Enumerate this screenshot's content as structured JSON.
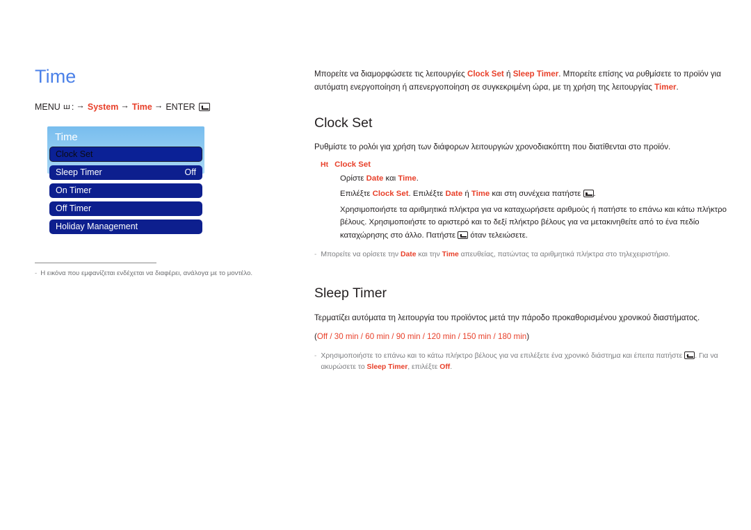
{
  "page": {
    "title": "Time"
  },
  "breadcrumb": {
    "menu_label": "MENU",
    "menu_glyph": "ш",
    "colon": ":",
    "arrow": "→",
    "step1": "System",
    "step2": "Time",
    "enter_label": "ENTER",
    "enter_icon": "enter-key-icon"
  },
  "osd": {
    "title": "Time",
    "items": [
      {
        "label": "Clock Set",
        "value": "",
        "selected": true
      },
      {
        "label": "Sleep Timer",
        "value": "Off",
        "selected": false
      },
      {
        "label": "On Timer",
        "value": "",
        "selected": false
      },
      {
        "label": "Off Timer",
        "value": "",
        "selected": false
      },
      {
        "label": "Holiday Management",
        "value": "",
        "selected": false
      }
    ]
  },
  "osd_footnote": {
    "dash": "-",
    "text": "Η εικόνα που εμφανίζεται ενδέχεται να διαφέρει, ανάλογα με το μοντέλο."
  },
  "intro": {
    "part1": "Μπορείτε να διαμορφώσετε τις λειτουργίες ",
    "term1": "Clock Set",
    "part2": " ή ",
    "term2": "Sleep Timer",
    "part3": ". Μπορείτε επίσης να ρυθμίσετε το προϊόν για αυτόματη ενεργοποίηση ή απενεργοποίηση σε συγκεκριμένη ώρα, με τη χρήση της λειτουργίας ",
    "term3": "Timer",
    "part4": "."
  },
  "clock_set": {
    "heading": "Clock Set",
    "lead": "Ρυθμίστε το ρολόι για χρήση των διάφορων λειτουργιών χρονοδιακόπτη που διατίθενται στο προϊόν.",
    "sub_marker": "Ht",
    "sub_title": "Clock Set",
    "sub_line1_a": "Ορίστε ",
    "sub_line1_b": "Date",
    "sub_line1_c": " και ",
    "sub_line1_d": "Time",
    "sub_line1_e": ".",
    "sub_line2_a": "Επιλέξτε ",
    "sub_line2_b": "Clock Set",
    "sub_line2_c": ". Επιλέξτε ",
    "sub_line2_d": "Date",
    "sub_line2_e": " ή ",
    "sub_line2_f": "Time",
    "sub_line2_g": " και στη συνέχεια πατήστε ",
    "sub_line2_h": ".",
    "sub_line3_a": "Χρησιμοποιήστε τα αριθμητικά πλήκτρα για να καταχωρήσετε αριθμούς ή πατήστε το επάνω και κάτω πλήκτρο βέλους. Χρησιμοποιήστε το αριστερό και το δεξί πλήκτρο βέλους για να μετακινηθείτε από το ένα πεδίο καταχώρησης στο άλλο. Πατήστε ",
    "sub_line3_b": " όταν τελειώσετε.",
    "tip_dash": "-",
    "tip_a": "Μπορείτε να ορίσετε την ",
    "tip_b": "Date",
    "tip_c": " και την ",
    "tip_d": "Time",
    "tip_e": " απευθείας, πατώντας τα αριθμητικά πλήκτρα στο τηλεχειριστήριο."
  },
  "sleep_timer": {
    "heading": "Sleep Timer",
    "lead": "Τερματίζει αυτόματα τη λειτουργία του προϊόντος μετά την πάροδο προκαθορισμένου χρονικού διαστήματος.",
    "options_open": "(",
    "options": "Off / 30 min / 60 min / 90 min / 120 min / 150 min / 180 min",
    "options_close": ")",
    "tip_dash": "-",
    "tip_a": "Χρησιμοποιήστε το επάνω και το κάτω πλήκτρο βέλους για να επιλέξετε ένα χρονικό διάστημα και έπειτα πατήστε ",
    "tip_b": ". Για να ακυρώσετε το ",
    "tip_c": "Sleep Timer",
    "tip_d": ", επιλέξτε ",
    "tip_e": "Off",
    "tip_f": "."
  },
  "colors": {
    "accent_red": "#e8402a",
    "title_blue": "#4b81e8",
    "osd_item_blue": "#0d1f8e",
    "osd_header_blue": "#8dc9f1"
  }
}
